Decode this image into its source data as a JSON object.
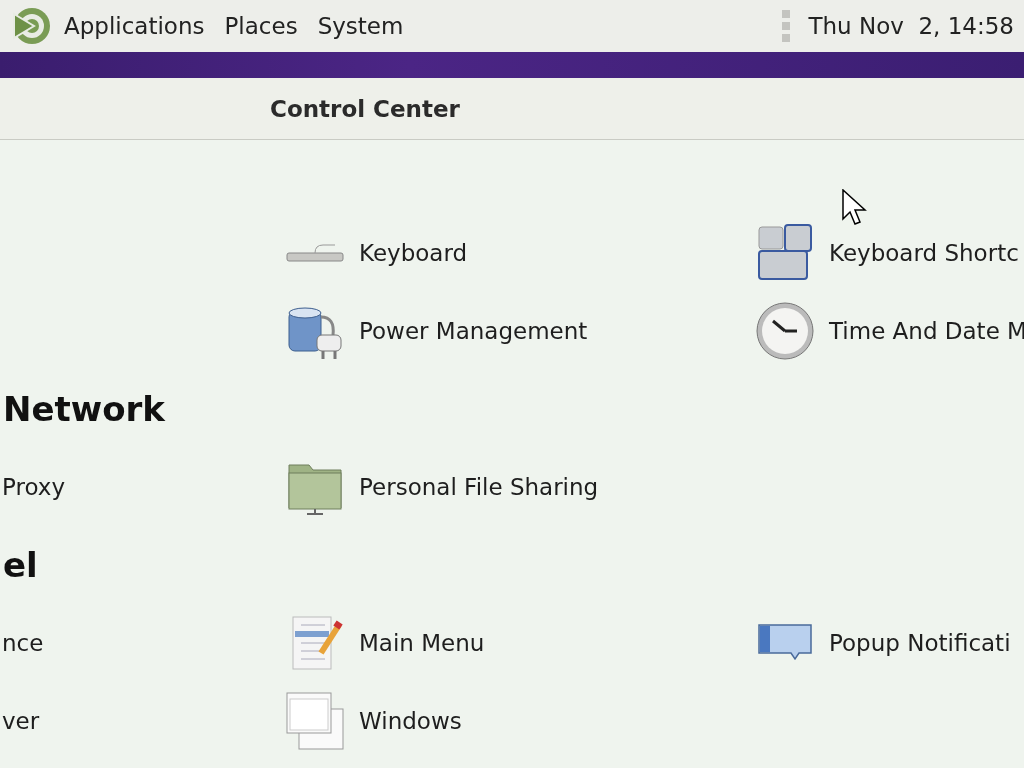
{
  "top_panel": {
    "menus": [
      "Applications",
      "Places",
      "System"
    ],
    "clock": "Thu Nov  2, 14:58"
  },
  "window": {
    "title": "Control Center"
  },
  "sections": [
    {
      "rows": [
        {
          "middle": "Keyboard",
          "right": "Keyboard Shortc"
        },
        {
          "middle": "Power Management",
          "right": "Time And Date M"
        }
      ]
    },
    {
      "heading": "Network",
      "rows": [
        {
          "left": "Proxy",
          "middle": "Personal File Sharing"
        }
      ]
    },
    {
      "heading": "el",
      "rows": [
        {
          "left": "nce",
          "middle": "Main Menu",
          "right": "Popup Notificati"
        },
        {
          "left": "ver",
          "middle": "Windows"
        }
      ]
    }
  ]
}
